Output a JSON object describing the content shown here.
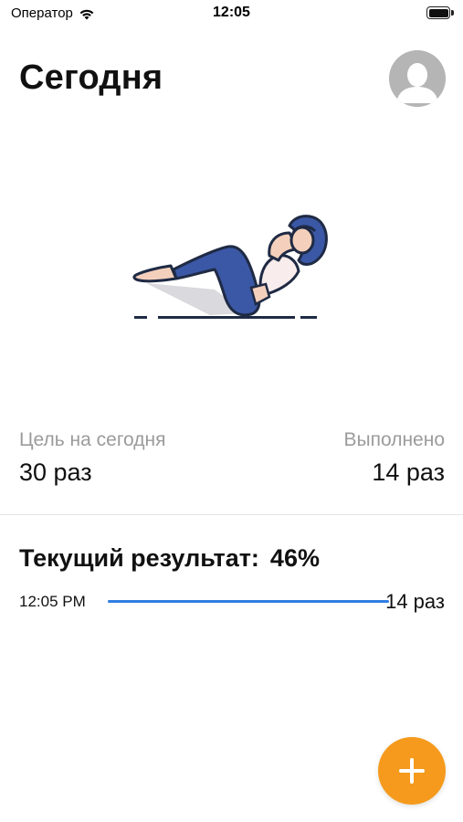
{
  "status_bar": {
    "carrier": "Оператор",
    "time": "12:05"
  },
  "header": {
    "title": "Сегодня",
    "avatar_icon": "user-avatar-icon"
  },
  "illustration": {
    "icon": "woman-doing-crunches-illustration"
  },
  "stats": {
    "goal_label": "Цель на сегодня",
    "goal_value": "30 раз",
    "done_label": "Выполнено",
    "done_value": "14 раз"
  },
  "result": {
    "title": "Текущий результат:",
    "percent": "46%",
    "progress_fraction": 1.0,
    "time": "12:05 PM",
    "count": "14 раз"
  },
  "fab": {
    "icon": "plus-icon"
  },
  "colors": {
    "accent_blue": "#2f7de1",
    "fab_orange": "#f59a1c",
    "muted_text": "#9b9b9b"
  }
}
